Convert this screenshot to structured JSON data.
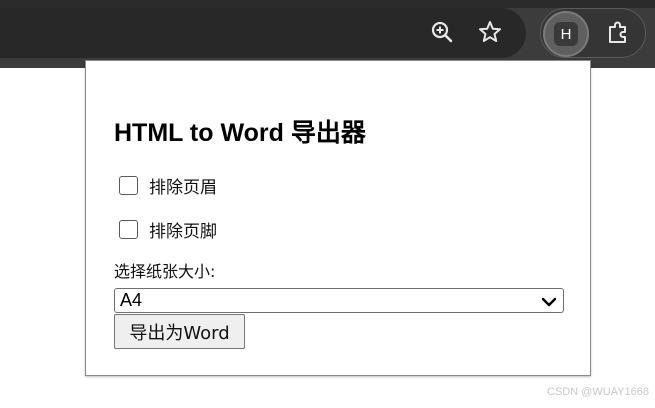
{
  "toolbar": {
    "zoom_icon": "zoom-in-icon",
    "bookmark_icon": "star-icon",
    "extension_letter": "H",
    "extensions_icon": "puzzle-icon"
  },
  "popup": {
    "title": "HTML to Word 导出器",
    "exclude_header_label": "排除页眉",
    "exclude_header_checked": false,
    "exclude_footer_label": "排除页脚",
    "exclude_footer_checked": false,
    "paper_size_label": "选择纸张大小:",
    "paper_size_selected": "A4",
    "export_button_label": "导出为Word"
  },
  "watermark": "CSDN @WUAY1668",
  "colors": {
    "browser_toolbar": "#3c3c3c",
    "omnibox": "#282828",
    "popup_bg": "#ffffff",
    "button_bg": "#efefef"
  }
}
